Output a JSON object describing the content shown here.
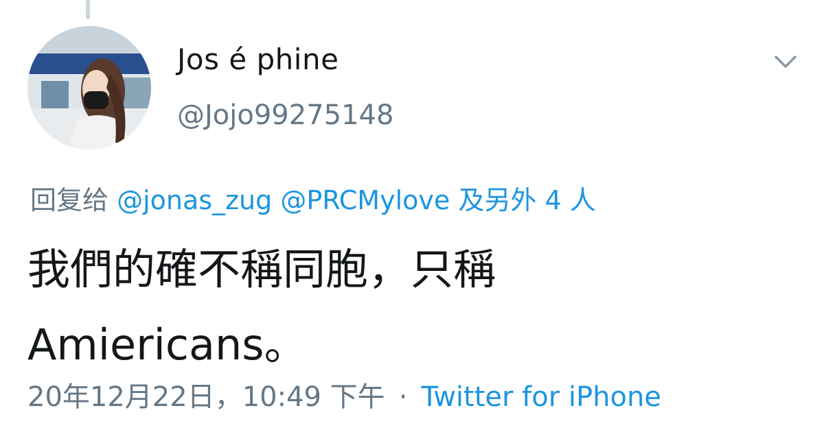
{
  "tweet": {
    "author": {
      "display_name": "Jos é phine",
      "handle": "@Jojo99275148"
    },
    "reply": {
      "prefix": "回复给",
      "mentions": [
        "@jonas_zug",
        "@PRCMylove"
      ],
      "others": "及另外 4 人"
    },
    "text_lines": [
      "我們的確不稱同胞，只稱",
      "Amiericans。"
    ],
    "timestamp": "20年12月22日，10:49 下午",
    "separator": "·",
    "source": "Twitter for iPhone",
    "icons": {
      "menu": "chevron-down-icon"
    },
    "colors": {
      "link": "#1b95e0",
      "secondary": "#657786",
      "primary": "#14171a"
    }
  }
}
